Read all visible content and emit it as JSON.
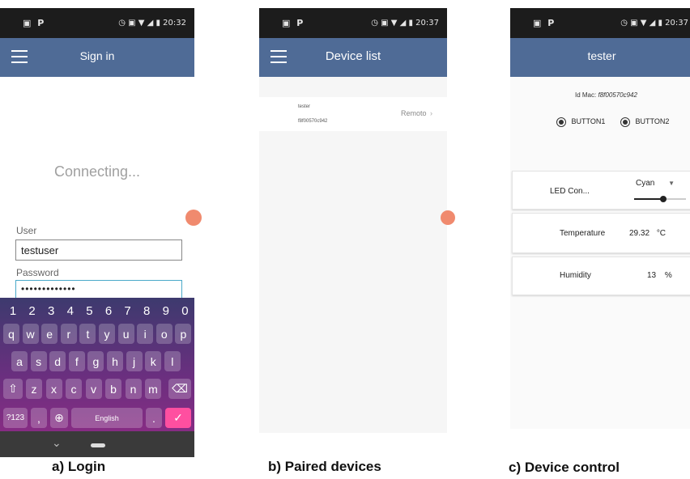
{
  "panels": {
    "login": {
      "status": {
        "left_icons": "▣ P",
        "right": "◷ ▣ ▼ ◢ ▮ 20:32"
      },
      "title": "Sign in",
      "connecting": "Connecting...",
      "user_label": "User",
      "user_value": "testuser",
      "password_label": "Password",
      "password_value": "•••••••••••••",
      "keyboard": {
        "numbers": [
          "1",
          "2",
          "3",
          "4",
          "5",
          "6",
          "7",
          "8",
          "9",
          "0"
        ],
        "row1": [
          "q",
          "w",
          "e",
          "r",
          "t",
          "y",
          "u",
          "i",
          "o",
          "p"
        ],
        "row2": [
          "a",
          "s",
          "d",
          "f",
          "g",
          "h",
          "j",
          "k",
          "l"
        ],
        "row3": [
          "z",
          "x",
          "c",
          "v",
          "b",
          "n",
          "m"
        ],
        "sym_label": "?123",
        "comma": ",",
        "space_label": "English",
        "period": ".",
        "shift_icon": "⇧",
        "backspace_icon": "⌫",
        "globe_icon": "⊕",
        "enter_icon": "✓"
      },
      "nav": {
        "back_icon": "⌄"
      },
      "caption": "a) Login"
    },
    "devices": {
      "status": {
        "left_icons": "▣ P",
        "right": "◷ ▣ ▼ ◢ ▮ 20:37"
      },
      "title": "Device list",
      "device": {
        "name": "tester",
        "mac": "f8f00570c942",
        "action": "Remoto"
      },
      "caption": "b) Paired devices"
    },
    "control": {
      "status": {
        "left_icons": "▣ P",
        "right": "◷ ▣ ▼ ◢ ▮ 20:37"
      },
      "title": "tester",
      "mac_label": "Id Mac:",
      "mac_value": "f8f00570c942",
      "button1": "BUTTON1",
      "button2": "BUTTON2",
      "led_label": "LED Con...",
      "led_value": "Cyan",
      "temp_label": "Temperature",
      "temp_value": "29.32",
      "temp_unit": "°C",
      "hum_label": "Humidity",
      "hum_value": "13",
      "hum_unit": "%",
      "caption": "c) Device control"
    }
  },
  "colors": {
    "appbar": "#4f6b96",
    "statusbar": "#1c1c1c",
    "accent": "#ff4fa0",
    "fab": "#f08a6e"
  }
}
